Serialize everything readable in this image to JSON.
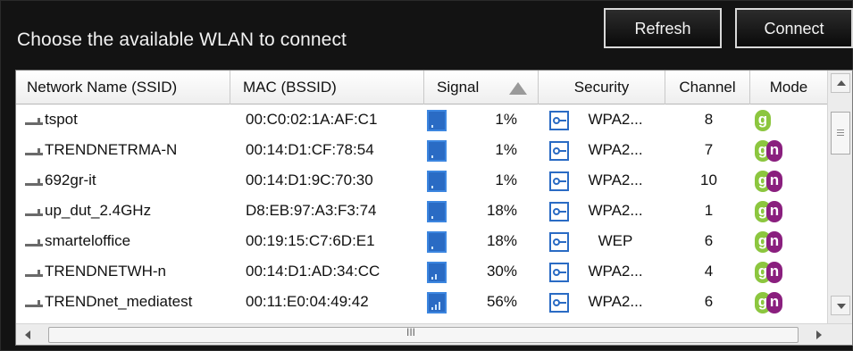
{
  "title": "Choose the available WLAN to connect",
  "buttons": {
    "refresh": "Refresh",
    "connect": "Connect"
  },
  "columns": [
    "Network Name (SSID)",
    "MAC (BSSID)",
    "Signal",
    "Security",
    "Channel",
    "Mode"
  ],
  "sort": {
    "column": "Signal",
    "direction": "ascending"
  },
  "networks": [
    {
      "ssid": "tspot",
      "mac": "00:C0:02:1A:AF:C1",
      "signal": "1%",
      "security": "WPA2...",
      "channel": "8",
      "mode": [
        "g"
      ]
    },
    {
      "ssid": "TRENDNETRMA-N",
      "mac": "00:14:D1:CF:78:54",
      "signal": "1%",
      "security": "WPA2...",
      "channel": "7",
      "mode": [
        "g",
        "n"
      ]
    },
    {
      "ssid": "692gr-it",
      "mac": "00:14:D1:9C:70:30",
      "signal": "1%",
      "security": "WPA2...",
      "channel": "10",
      "mode": [
        "g",
        "n"
      ]
    },
    {
      "ssid": "up_dut_2.4GHz",
      "mac": "D8:EB:97:A3:F3:74",
      "signal": "18%",
      "security": "WPA2...",
      "channel": "1",
      "mode": [
        "g",
        "n"
      ]
    },
    {
      "ssid": "smarteloffice",
      "mac": "00:19:15:C7:6D:E1",
      "signal": "18%",
      "security": "WEP",
      "channel": "6",
      "mode": [
        "g",
        "n"
      ]
    },
    {
      "ssid": "TRENDNETWH-n",
      "mac": "00:14:D1:AD:34:CC",
      "signal": "30%",
      "security": "WPA2...",
      "channel": "4",
      "mode": [
        "g",
        "n"
      ]
    },
    {
      "ssid": "TRENDnet_mediatest",
      "mac": "00:11:E0:04:49:42",
      "signal": "56%",
      "security": "WPA2...",
      "channel": "6",
      "mode": [
        "g",
        "n"
      ]
    }
  ],
  "colors": {
    "panel_bg": "#131313",
    "signal_blue": "#2a6bc4",
    "mode_g": "#8cc63f",
    "mode_n": "#8a1f7e"
  },
  "icons": {
    "network": "wifi-network-icon",
    "signal": "signal-strength-icon",
    "security": "lock-key-icon",
    "sort": "sort-ascending-icon"
  },
  "hscroll_grip": "III"
}
